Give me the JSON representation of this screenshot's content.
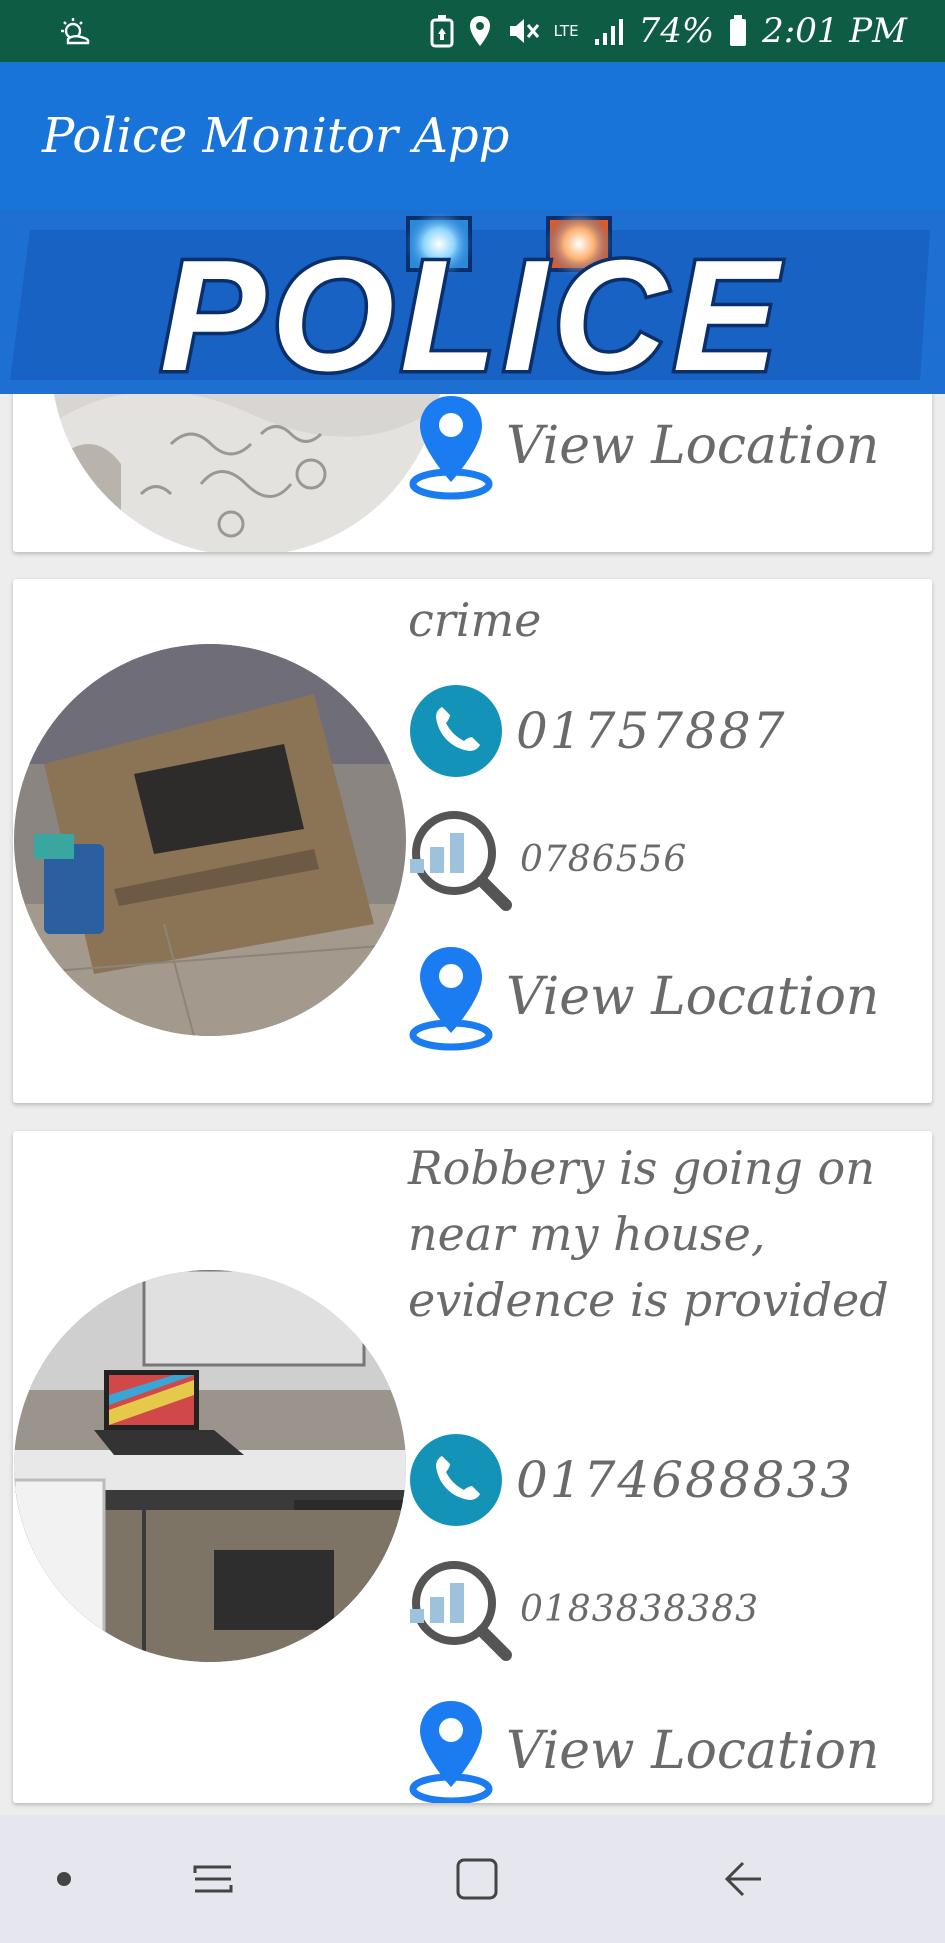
{
  "status_bar": {
    "network": "LTE",
    "battery": "74%",
    "time": "2:01 PM"
  },
  "app_bar": {
    "title": "Police Monitor App"
  },
  "banner": {
    "logo_text": "POLICE"
  },
  "reports": [
    {
      "description": "",
      "phone": "",
      "stats": "",
      "location_label": "View Location"
    },
    {
      "description": "crime",
      "phone": "01757887",
      "stats": "0786556",
      "location_label": "View Location"
    },
    {
      "description": "Robbery is going on near my house, evidence is provided",
      "phone": "0174688833",
      "stats": "0183838383",
      "location_label": "View Location"
    }
  ],
  "colors": {
    "status_bar": "#0e5c43",
    "app_bar": "#1874d8",
    "phone_icon": "#1493b8",
    "location_icon": "#1a7cf0",
    "text": "#6a6a6a"
  },
  "icons": [
    "phone-icon",
    "stats-search-icon",
    "location-pin-icon"
  ]
}
